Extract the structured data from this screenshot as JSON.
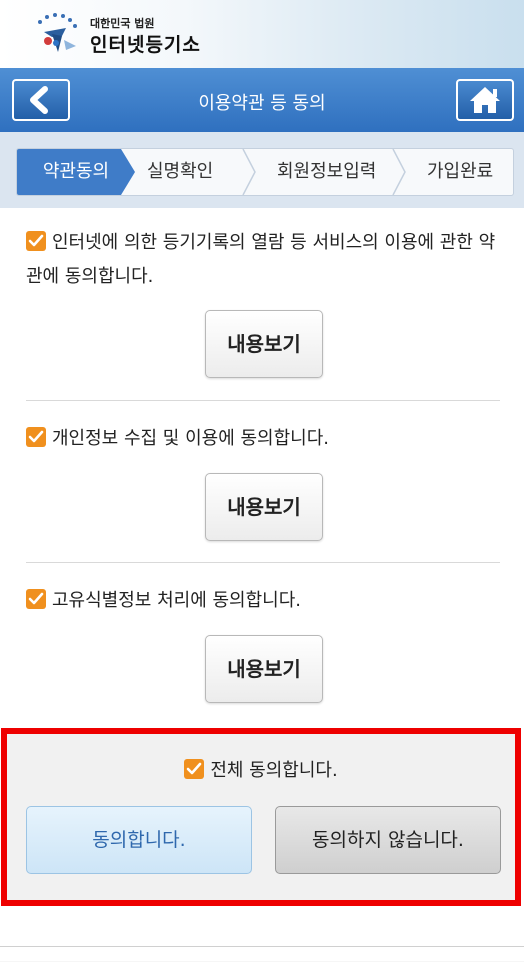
{
  "header": {
    "org_small": "대한민국 법원",
    "org_name": "인터넷등기소"
  },
  "title_bar": {
    "title": "이용약관 등 동의"
  },
  "steps": [
    {
      "label": "약관동의",
      "active": true
    },
    {
      "label": "실명확인",
      "active": false
    },
    {
      "label": "회원정보입력",
      "active": false
    },
    {
      "label": "가입완료",
      "active": false
    }
  ],
  "terms": [
    {
      "text": "인터넷에 의한 등기기록의 열람 등 서비스의 이용에 관한 약관에 동의합니다.",
      "checked": true,
      "button": "내용보기"
    },
    {
      "text": "개인정보 수집 및 이용에 동의합니다.",
      "checked": true,
      "button": "내용보기"
    },
    {
      "text": "고유식별정보 처리에 동의합니다.",
      "checked": true,
      "button": "내용보기"
    }
  ],
  "agreement": {
    "all_label": "전체 동의합니다.",
    "all_checked": true,
    "agree_label": "동의합니다.",
    "disagree_label": "동의하지 않습니다."
  },
  "colors": {
    "accent": "#3f7cc8",
    "checkbox": "#f0901e",
    "highlight": "#ee0000"
  }
}
